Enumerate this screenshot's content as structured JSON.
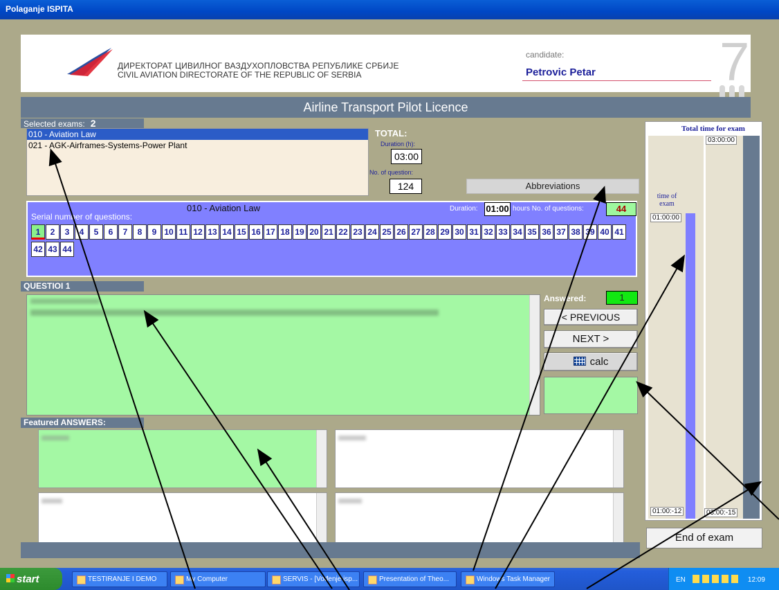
{
  "window": {
    "title": "Polaganje ISPITA"
  },
  "header": {
    "org_line1": "ДИРЕКТОРАТ ЦИВИЛНОГ ВАЗДУХОПЛОВСТВА РЕПУБЛИКЕ СРБИЈЕ",
    "org_line2": "CIVIL AVIATION DIRECTORATE OF THE REPUBLIC OF SERBIA",
    "candidate_label": "candidate:",
    "candidate_name": "Petrovic Petar",
    "big_digit": "7"
  },
  "title": "Airline Transport Pilot Licence",
  "selected_exams": {
    "label": "Selected exams:",
    "count": "2",
    "items": [
      "010 - Aviation Law",
      "021 - AGK-Airframes-Systems-Power Plant"
    ]
  },
  "total": {
    "label": "TOTAL:",
    "duration_label": "Duration (h):",
    "duration": "03:00",
    "nq_label": "No. of question:",
    "nq": "124"
  },
  "abbreviations_label": "Abbreviations",
  "subject": {
    "title": "010 - Aviation Law",
    "serial_label": "Serial number of questions:",
    "duration_label": "Duration:",
    "duration": "01:00",
    "hours_label": "hours  No. of questions:",
    "nq": "44",
    "current_question": 1,
    "question_numbers": [
      "1",
      "2",
      "3",
      "4",
      "5",
      "6",
      "7",
      "8",
      "9",
      "10",
      "11",
      "12",
      "13",
      "14",
      "15",
      "16",
      "17",
      "18",
      "19",
      "20",
      "21",
      "22",
      "23",
      "24",
      "25",
      "26",
      "27",
      "28",
      "29",
      "30",
      "31",
      "32",
      "33",
      "34",
      "35",
      "36",
      "37",
      "38",
      "39",
      "40",
      "41",
      "42",
      "43",
      "44"
    ]
  },
  "question": {
    "label": "QUESTIOI",
    "number": "1"
  },
  "nav": {
    "answered_label": "Answered:",
    "answered": "1",
    "prev": "<  PREVIOUS",
    "next": "NEXT     >",
    "calc": "calc"
  },
  "answers_label": "Featured ANSWERS:",
  "timer": {
    "total_label": "Total time for exam",
    "total_start": "03:00:00",
    "total_end": "03:00:-15",
    "exam_label_1": "time of",
    "exam_label_2": "exam",
    "exam_start": "01:00:00",
    "exam_end": "01:00:-12"
  },
  "end_label": "End of exam",
  "taskbar": {
    "start": "start",
    "tasks": [
      "TESTIRANJE I DEMO",
      "My Computer",
      "SERVIS - [Vođenje isp...",
      "Presentation of Theo...",
      "Windows Task Manager"
    ],
    "lang": "EN",
    "clock": "12:09"
  },
  "colors": {
    "panel": "#ACA98A",
    "accent": "#677A90",
    "answer_green": "#A4F8A4",
    "blue_panel": "#8080FF"
  }
}
